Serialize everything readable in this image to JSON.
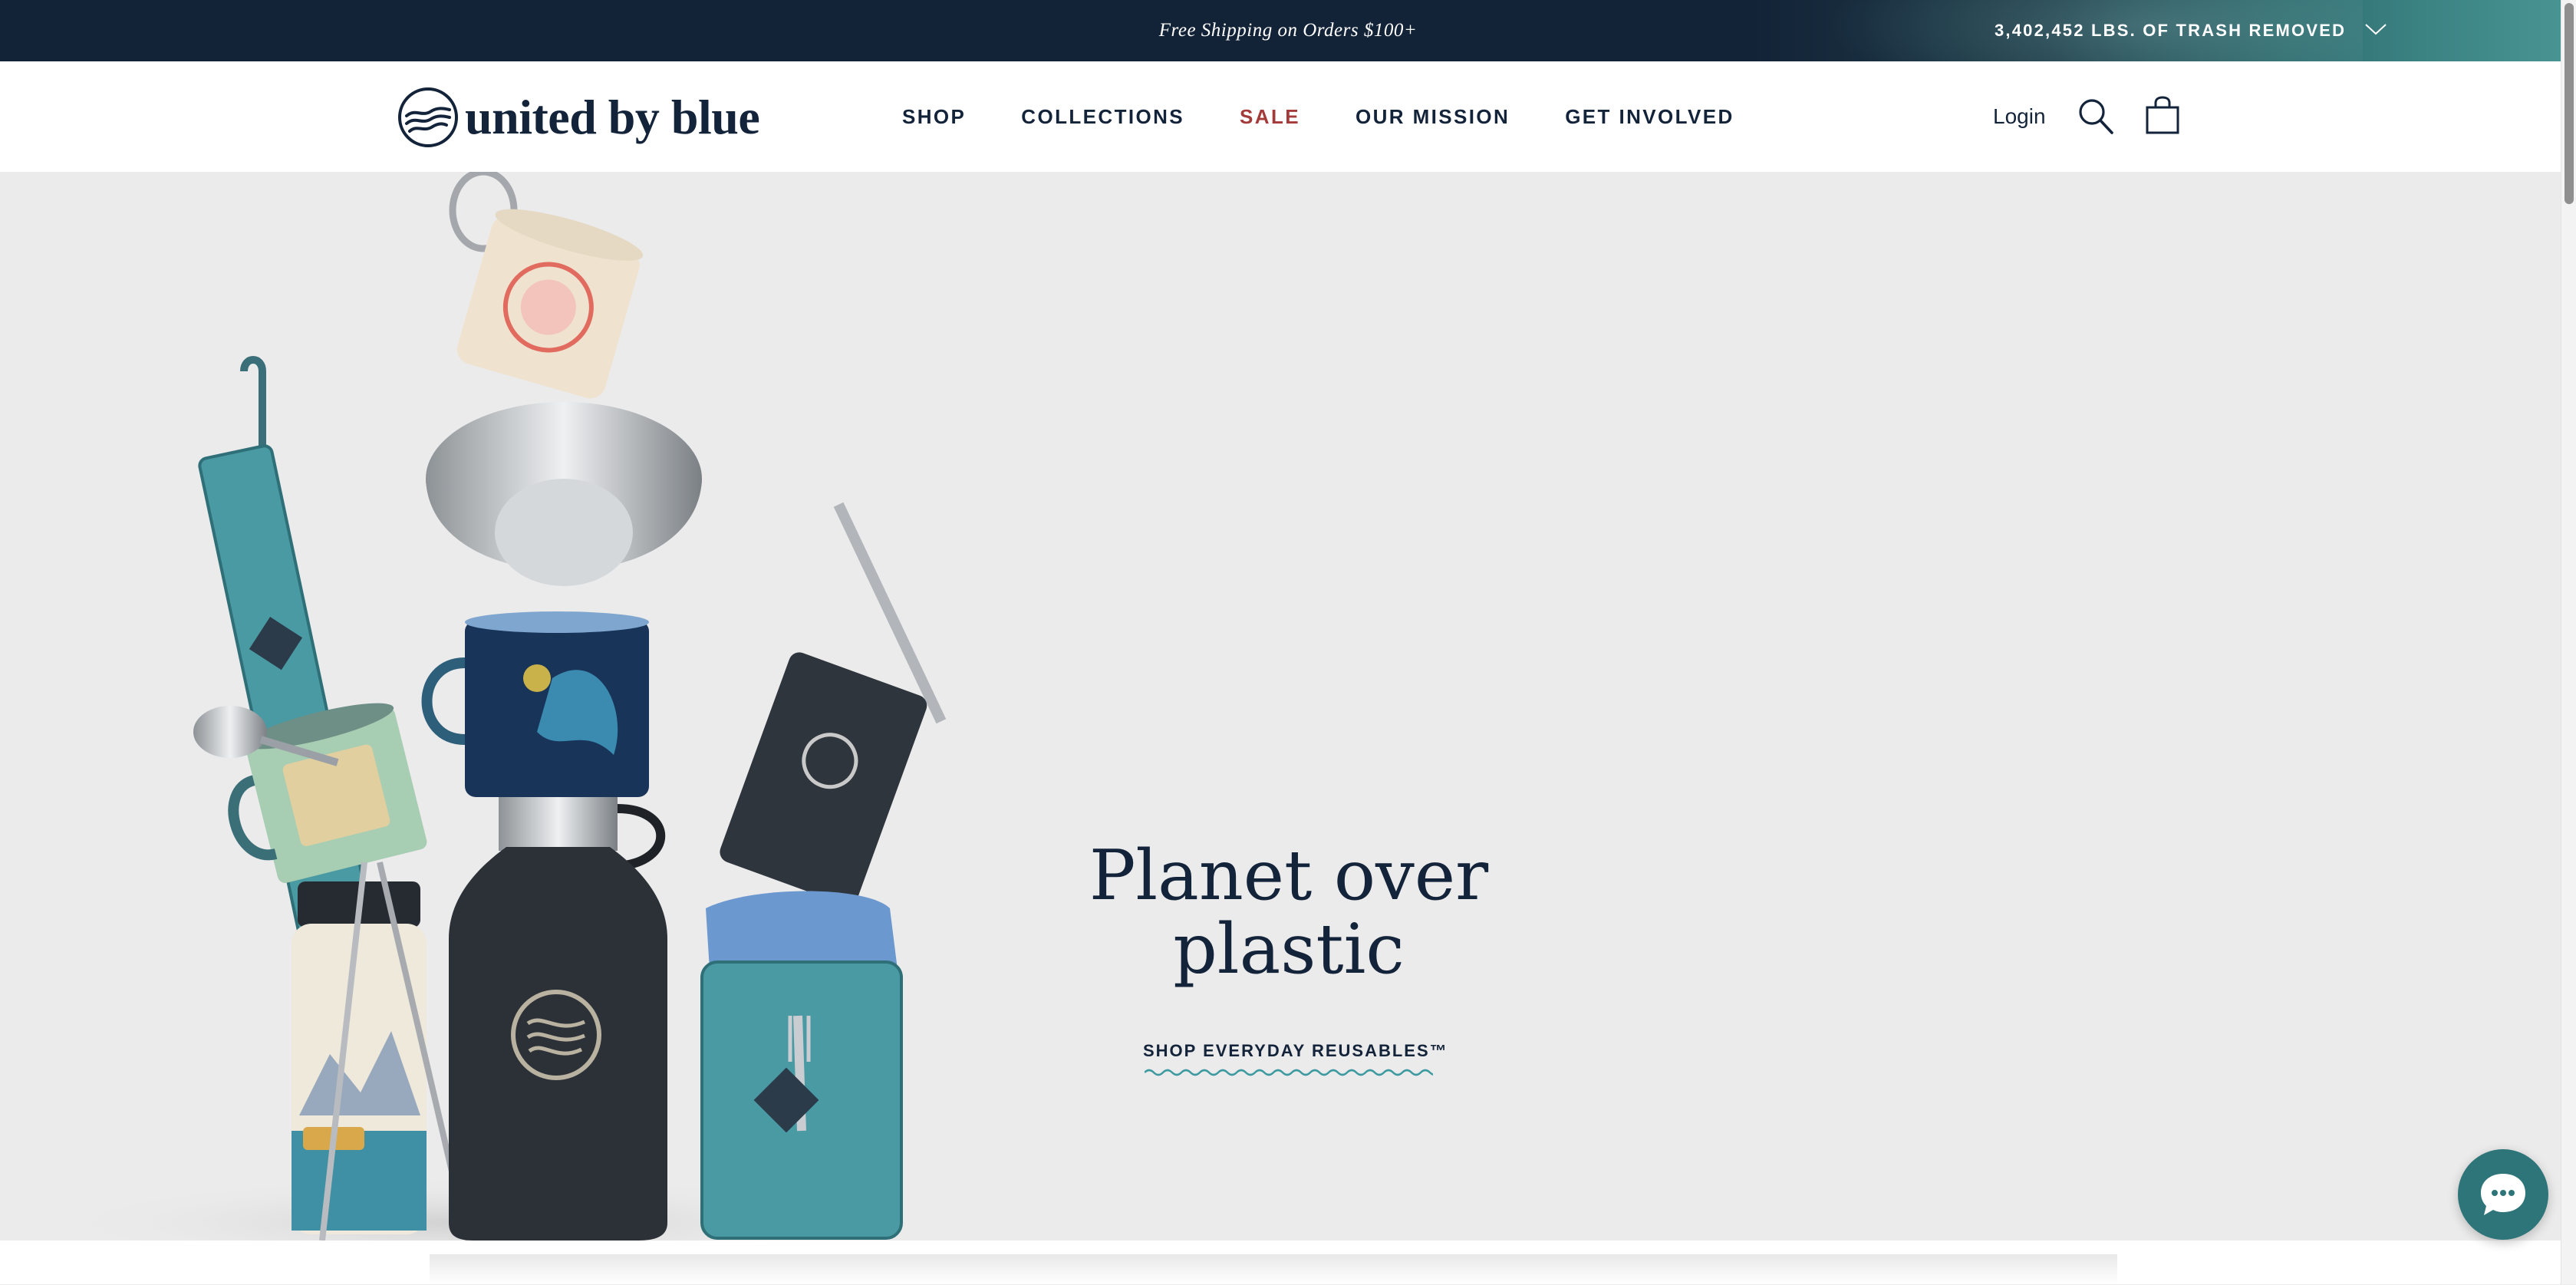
{
  "announcement": {
    "shipping_text": "Free Shipping on Orders $100+",
    "trash_counter": "3,402,452 LBS. OF TRASH REMOVED"
  },
  "header": {
    "logo_text": "united by blue",
    "nav": [
      {
        "label": "SHOP"
      },
      {
        "label": "COLLECTIONS"
      },
      {
        "label": "SALE",
        "color": "#a33b3b"
      },
      {
        "label": "OUR MISSION"
      },
      {
        "label": "GET INVOLVED"
      }
    ],
    "login_label": "Login",
    "icons": [
      "search-icon",
      "shopping-bag-icon"
    ]
  },
  "hero": {
    "title": "Planet over plastic",
    "cta_label": "SHOP EVERYDAY REUSABLES™",
    "image_icon": "product-collage-icon"
  },
  "chat": {
    "icon": "chat-bubble-icon"
  },
  "colors": {
    "navy": "#13233a",
    "sale_red": "#a33b3b",
    "teal": "#2e7579",
    "hero_bg": "#ebebeb"
  }
}
